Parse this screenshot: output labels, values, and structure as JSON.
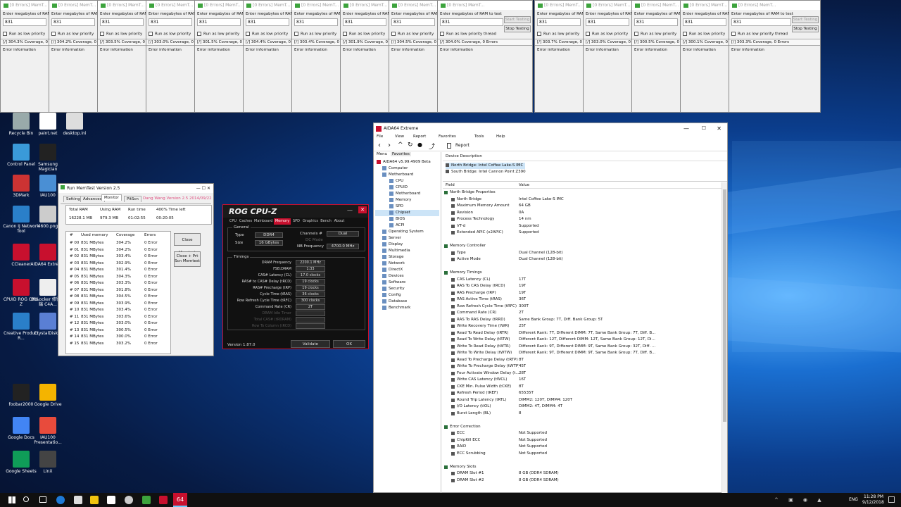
{
  "memtest_top": {
    "title": "[0 Errors] MemT...",
    "prompt": "Enter megabytes of RAM to test",
    "value": "831",
    "checkbox": "Run as low priority thread",
    "error_label": "Error information",
    "start_btn": "Start Testing",
    "stop_btn": "Stop Testing",
    "coverages": [
      "[/]  304.3% Coverage, 0 Err",
      "[/]  304.2% Coverage, 0 Err",
      "[/]  303.5% Coverage, 0 Err",
      "[/]  303.0% Coverage, 0 Err",
      "[/]  301.5% Coverage, 0 Err",
      "[/]  304.4% Coverage, 0 Err",
      "[/]  303.4% Coverage, 0 Err",
      "[/]  301.9% Coverage, 0 Err",
      "[/]  304.5% Coverage, 0 Err",
      "[/]  304.0% Coverage, 0 Errors",
      "[/]  303.7% Coverage, 0 Err",
      "[/]  303.0% Coverage, 0 Err",
      "[/]  300.5% Coverage, 0 Err",
      "[/]  300.1% Coverage, 0 Err",
      "[/]  303.3% Coverage, 0 Errors"
    ]
  },
  "desktop_icons": [
    "Recycle Bin",
    "paint.net",
    "desktop.ini",
    "Control Panel",
    "Samsung Magician",
    "3DMark",
    "IAU100",
    "Canon IJ Network Tool",
    "4600.png",
    "CCleaner",
    "AIDA64 Extreme",
    "CPUID ROG CPU-Z",
    "BitLocker 修復金鑰 C4A...",
    "Creative Product R...",
    "CrystalDisk...",
    "foobar2000",
    "Google Drive",
    "Google Docs",
    "IAU100 Presentatio...",
    "Google Sheets",
    "LinX"
  ],
  "runmemtest": {
    "title": "Run MemTest Version 2.5",
    "tabs": [
      "Setting",
      "Advanced",
      "Monitor",
      "PitScn"
    ],
    "version_label": "Dang Wang Version 2.5 2014/09/22",
    "headers": [
      "Total RAM",
      "Using RAM",
      "Run time",
      "400% Time left"
    ],
    "values": [
      "16228.1 MB",
      "979.3 MB",
      "01:02:55",
      "00:20:05"
    ],
    "col_headers": [
      "#",
      "Used memory",
      "Coverage",
      "Errors"
    ],
    "rows": [
      [
        "# 00",
        "831 MBytes",
        "304.2%",
        "0 Error"
      ],
      [
        "# 01",
        "831 MBytes",
        "304.2%",
        "0 Error"
      ],
      [
        "# 02",
        "831 MBytes",
        "303.4%",
        "0 Error"
      ],
      [
        "# 03",
        "831 MBytes",
        "302.9%",
        "0 Error"
      ],
      [
        "# 04",
        "831 MBytes",
        "301.4%",
        "0 Error"
      ],
      [
        "# 05",
        "831 MBytes",
        "304.3%",
        "0 Error"
      ],
      [
        "# 06",
        "831 MBytes",
        "303.3%",
        "0 Error"
      ],
      [
        "# 07",
        "831 MBytes",
        "301.8%",
        "0 Error"
      ],
      [
        "# 08",
        "831 MBytes",
        "304.5%",
        "0 Error"
      ],
      [
        "# 09",
        "831 MBytes",
        "303.9%",
        "0 Error"
      ],
      [
        "# 10",
        "831 MBytes",
        "303.4%",
        "0 Error"
      ],
      [
        "# 11",
        "831 MBytes",
        "303.6%",
        "0 Error"
      ],
      [
        "# 12",
        "831 MBytes",
        "303.0%",
        "0 Error"
      ],
      [
        "# 13",
        "831 MBytes",
        "300.5%",
        "0 Error"
      ],
      [
        "# 14",
        "831 MBytes",
        "300.0%",
        "0 Error"
      ],
      [
        "# 15",
        "831 MBytes",
        "303.2%",
        "0 Error"
      ]
    ],
    "close_btn": "Close Memtest",
    "close_pnt_btn": "Close + Prt Scn Memtest"
  },
  "cpuz": {
    "title": "ROG CPU-Z",
    "tabs": [
      "CPU",
      "Caches",
      "Mainboard",
      "Memory",
      "SPD",
      "Graphics",
      "Bench",
      "About"
    ],
    "general_label": "General",
    "type_label": "Type",
    "type_val": "DDR4",
    "size_label": "Size",
    "size_val": "16 GBytes",
    "channels_label": "Channels #",
    "channels_val": "Dual",
    "dcmode_label": "DC Mode",
    "nbfreq_label": "NB Frequency",
    "nbfreq_val": "4700.0 MHz",
    "timings_label": "Timings",
    "timings": [
      [
        "DRAM Frequency",
        "2200.1 MHz"
      ],
      [
        "FSB:DRAM",
        "1:33"
      ],
      [
        "CAS# Latency (CL)",
        "17.0 clocks"
      ],
      [
        "RAS# to CAS# Delay (tRCD)",
        "19 clocks"
      ],
      [
        "RAS# Precharge (tRP)",
        "19 clocks"
      ],
      [
        "Cycle Time (tRAS)",
        "36 clocks"
      ],
      [
        "Row Refresh Cycle Time (tRFC)",
        "300 clocks"
      ],
      [
        "Command Rate (CR)",
        "2T"
      ],
      [
        "DRAM Idle Timer",
        ""
      ],
      [
        "Total CAS# (tRDRAM)",
        ""
      ],
      [
        "Row To Column (tRCD)",
        ""
      ]
    ],
    "version": "Version 1.87.0",
    "validate": "Validate",
    "ok": "OK"
  },
  "aida": {
    "title": "AIDA64 Extreme",
    "menu": [
      "File",
      "View",
      "Report",
      "Favorites",
      "Tools",
      "Help"
    ],
    "report_btn": "Report",
    "panel_tabs": [
      "Menu",
      "Favorites"
    ],
    "tree": [
      "AIDA64 v5.99.4909 Beta",
      "Computer",
      "Motherboard",
      "CPU",
      "CPUID",
      "Motherboard",
      "Memory",
      "SPD",
      "Chipset",
      "BIOS",
      "ACPI",
      "Operating System",
      "Server",
      "Display",
      "Multimedia",
      "Storage",
      "Network",
      "DirectX",
      "Devices",
      "Software",
      "Security",
      "Config",
      "Database",
      "Benchmark"
    ],
    "device_desc_label": "Device Description",
    "devices": [
      "North Bridge: Intel Coffee Lake-S IMC",
      "South Bridge: Intel Cannon Point Z390"
    ],
    "field_header": "Field",
    "value_header": "Value",
    "rows": [
      [
        "h",
        "North Bridge Properties",
        ""
      ],
      [
        "f",
        "North Bridge",
        "Intel Coffee Lake-S IMC"
      ],
      [
        "f",
        "Maximum Memory Amount",
        "64 GB"
      ],
      [
        "f",
        "Revision",
        "0A"
      ],
      [
        "f",
        "Process Technology",
        "14 nm"
      ],
      [
        "f",
        "VT-d",
        "Supported"
      ],
      [
        "f",
        "Extended APIC (x2APIC)",
        "Supported"
      ],
      [
        "s",
        "",
        ""
      ],
      [
        "h",
        "Memory Controller",
        ""
      ],
      [
        "f",
        "Type",
        "Dual Channel  (128-bit)"
      ],
      [
        "f",
        "Active Mode",
        "Dual Channel  (128-bit)"
      ],
      [
        "s",
        "",
        ""
      ],
      [
        "h",
        "Memory Timings",
        ""
      ],
      [
        "f",
        "CAS Latency (CL)",
        "17T"
      ],
      [
        "f",
        "RAS To CAS Delay (tRCD)",
        "19T"
      ],
      [
        "f",
        "RAS Precharge (tRP)",
        "19T"
      ],
      [
        "f",
        "RAS Active Time (tRAS)",
        "36T"
      ],
      [
        "f",
        "Row Refresh Cycle Time (tRFC)",
        "300T"
      ],
      [
        "f",
        "Command Rate (CR)",
        "2T"
      ],
      [
        "f",
        "RAS To RAS Delay (tRRD)",
        "Same Bank Group: 7T, Diff. Bank Group: 5T"
      ],
      [
        "f",
        "Write Recovery Time (tWR)",
        "25T"
      ],
      [
        "f",
        "Read To Read Delay (tRTR)",
        "Different Rank: 7T, Different DIMM: 7T, Same Bank Group: 7T, Diff. B..."
      ],
      [
        "f",
        "Read To Write Delay (tRTW)",
        "Different Rank: 12T, Different DIMM: 12T, Same Bank Group: 12T, Di..."
      ],
      [
        "f",
        "Write To Read Delay (tWTR)",
        "Different Rank: 9T, Different DIMM: 9T, Same Bank Group: 32T, Diff. ..."
      ],
      [
        "f",
        "Write To Write Delay (tWTW)",
        "Different Rank: 9T, Different DIMM: 9T, Same Bank Group: 7T, Diff. B..."
      ],
      [
        "f",
        "Read To Precharge Delay (tRTP)",
        "8T"
      ],
      [
        "f",
        "Write To Precharge Delay (tWTP)",
        "45T"
      ],
      [
        "f",
        "Four Activate Window Delay (t...",
        "28T"
      ],
      [
        "f",
        "Write CAS Latency (tWCL)",
        "16T"
      ],
      [
        "f",
        "CKE Min. Pulse Width (tCKE)",
        "8T"
      ],
      [
        "f",
        "Refresh Period (tREF)",
        "65535T"
      ],
      [
        "f",
        "Round Trip Latency (tRTL)",
        "DIMM2: 120T, DIMM4: 120T"
      ],
      [
        "f",
        "I/O Latency (tIOL)",
        "DIMM2: 4T, DIMM4: 4T"
      ],
      [
        "f",
        "Burst Length (BL)",
        "8"
      ],
      [
        "s",
        "",
        ""
      ],
      [
        "h",
        "Error Correction",
        ""
      ],
      [
        "f",
        "ECC",
        "Not Supported"
      ],
      [
        "f",
        "ChipKill ECC",
        "Not Supported"
      ],
      [
        "f",
        "RAID",
        "Not Supported"
      ],
      [
        "f",
        "ECC Scrubbing",
        "Not Supported"
      ],
      [
        "s",
        "",
        ""
      ],
      [
        "h",
        "Memory Slots",
        ""
      ],
      [
        "f",
        "DRAM Slot #1",
        "8 GB  (DDR4 SDRAM)"
      ],
      [
        "f",
        "DRAM Slot #2",
        "8 GB  (DDR4 SDRAM)"
      ]
    ]
  },
  "taskbar": {
    "time": "11:28 PM",
    "date": "9/12/2018",
    "lang": "ENG"
  },
  "colors": {
    "cpuz_red": "#c8102e",
    "aida_blue": "#0a5fb4",
    "memtest_green": "#3da33d"
  }
}
